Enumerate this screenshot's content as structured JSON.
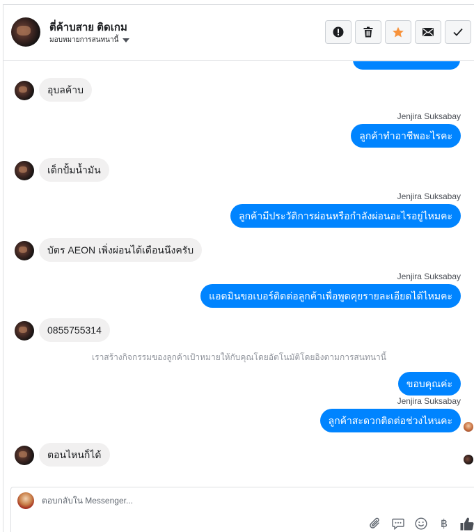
{
  "header": {
    "name": "ตี่ค้าบสาย ติดเกม",
    "assign_label": "มอบหมายการสนทนานี้",
    "actions": [
      {
        "name": "mark-spam-button",
        "icon": "alert-icon"
      },
      {
        "name": "delete-button",
        "icon": "trash-icon"
      },
      {
        "name": "star-button",
        "icon": "star-icon",
        "color": "#f7923b"
      },
      {
        "name": "mark-unread-button",
        "icon": "envelope-icon"
      },
      {
        "name": "mark-done-button",
        "icon": "check-icon"
      }
    ]
  },
  "messages": {
    "m1": "อุบลค้าบ",
    "s2": "Jenjira Suksabay",
    "m2": "ลูกค้าทำอาชีพอะไรคะ",
    "m3": "เด็กปั้มน้ำมัน",
    "s4": "Jenjira Suksabay",
    "m4": "ลูกค้ามีประวัติการผ่อนหรือกำลังผ่อนอะไรอยู่ไหมคะ",
    "m5": "บัตร AEON เพิ่งผ่อนได้เดือนนึงครับ",
    "s6": "Jenjira Suksabay",
    "m6": "แอดมินขอเบอร์ติดต่อลูกค้าเพื่อพูดคุยรายละเอียดได้ไหมคะ",
    "m7": "0855755314",
    "system_note": "เราสร้างกิจกรรมของลูกค้าเป้าหมายให้กับคุณโดยอัตโนมัติโดยอิงตามการสนทนานี้",
    "m8": "ขอบคุณค่ะ",
    "s9": "Jenjira Suksabay",
    "m9": "ลูกค้าสะดวกติดต่อช่วงไหนคะ",
    "m10": "ตอนไหนก็ได้"
  },
  "colors": {
    "outgoing": "#0084ff",
    "incoming": "#f1f0f0"
  },
  "composer": {
    "placeholder": "ตอบกลับใน Messenger...",
    "tools": [
      "paperclip-icon",
      "quick-reply-icon",
      "emoji-icon",
      "baht-icon",
      "thumbs-up-icon"
    ],
    "baht_symbol": "฿"
  }
}
